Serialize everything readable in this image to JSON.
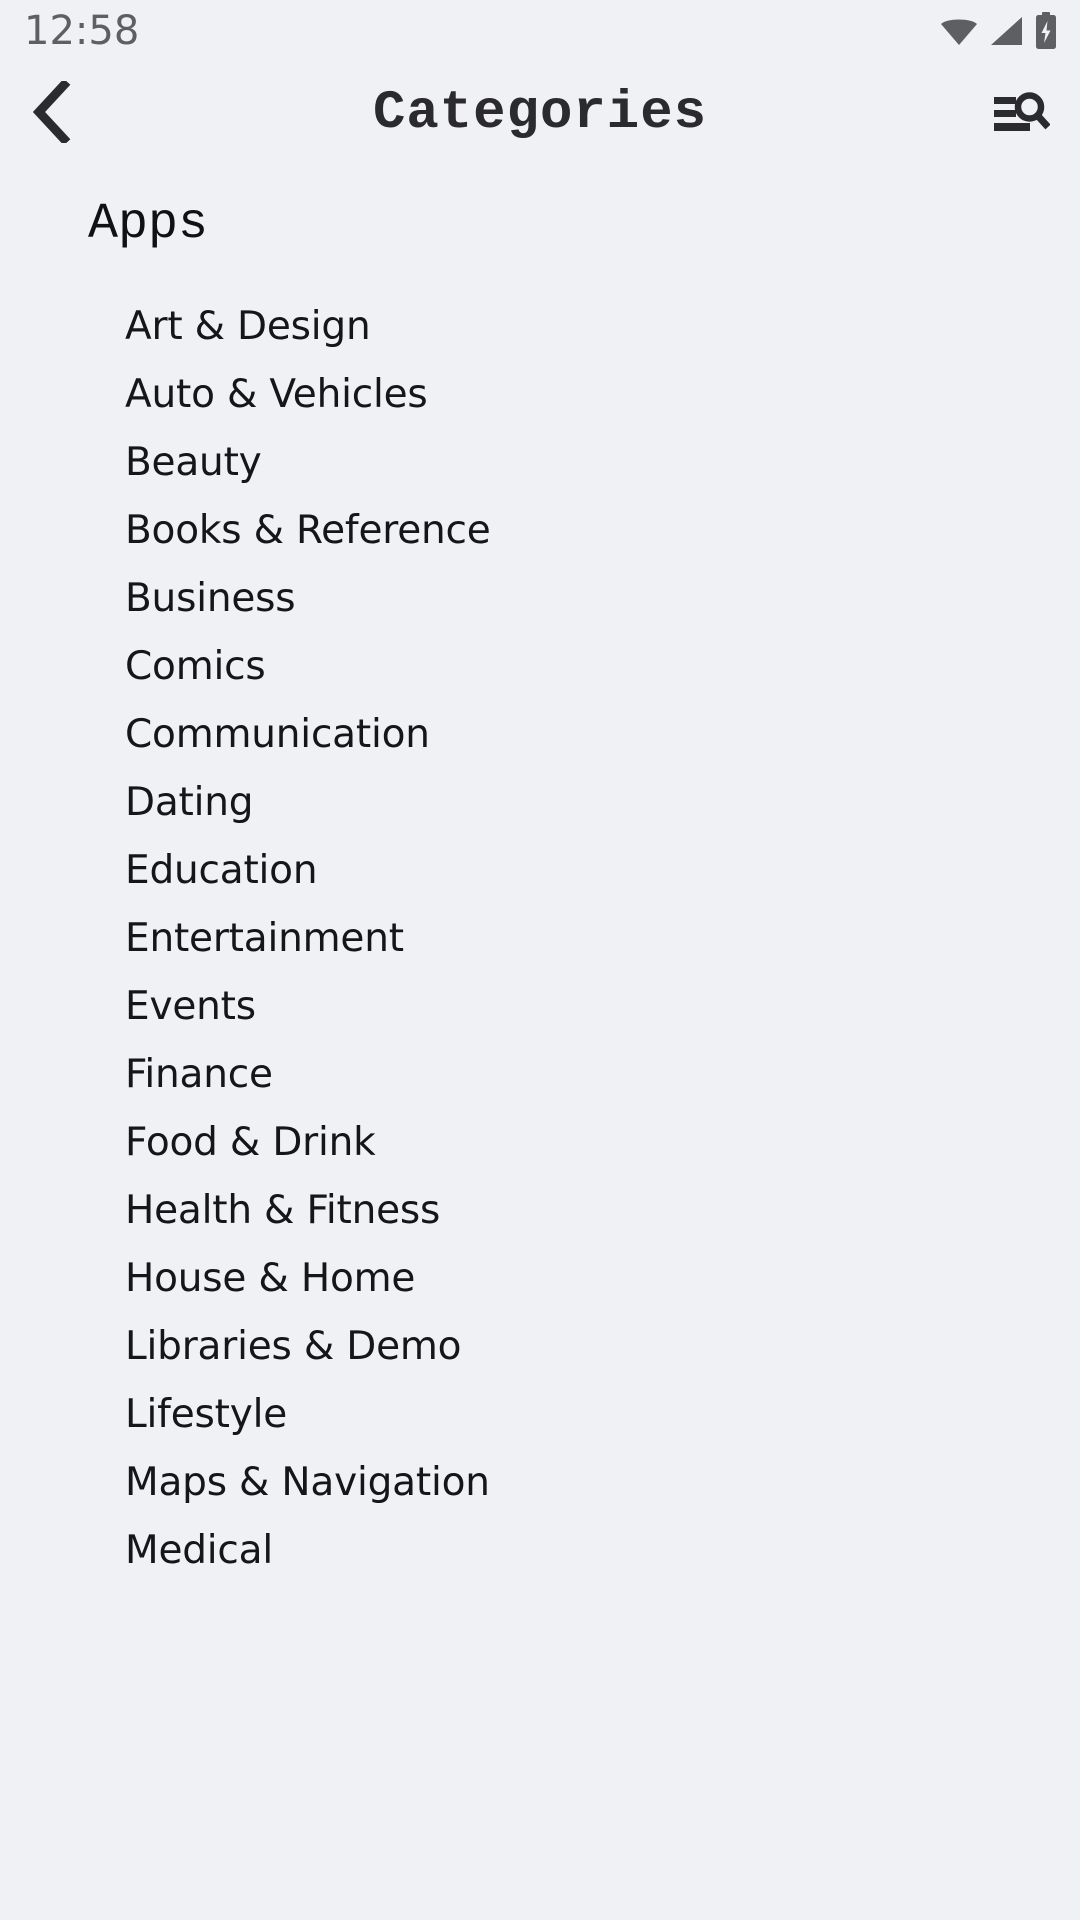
{
  "status_bar": {
    "time": "12:58",
    "icons": [
      {
        "name": "wifi-icon",
        "label": "wifi"
      },
      {
        "name": "cellular-signal-icon",
        "label": "cellular signal"
      },
      {
        "name": "battery-charging-icon",
        "label": "battery charging"
      }
    ],
    "icon_color": "#5d5f63"
  },
  "app_bar": {
    "back_label": "‹",
    "title": "Categories",
    "filter_search_label": "filter and search"
  },
  "content": {
    "section_header": "Apps",
    "categories": [
      {
        "label": "Art & Design"
      },
      {
        "label": "Auto & Vehicles"
      },
      {
        "label": "Beauty"
      },
      {
        "label": "Books & Reference"
      },
      {
        "label": "Business"
      },
      {
        "label": "Comics"
      },
      {
        "label": "Communication"
      },
      {
        "label": "Dating"
      },
      {
        "label": "Education"
      },
      {
        "label": "Entertainment"
      },
      {
        "label": "Events"
      },
      {
        "label": "Finance"
      },
      {
        "label": "Food & Drink"
      },
      {
        "label": "Health & Fitness"
      },
      {
        "label": "House & Home"
      },
      {
        "label": "Libraries & Demo"
      },
      {
        "label": "Lifestyle"
      },
      {
        "label": "Maps & Navigation"
      },
      {
        "label": "Medical"
      }
    ]
  },
  "colors": {
    "background": "#f0f1f5",
    "primary_text": "#15161a",
    "title_text": "#2b2b2d",
    "status_text": "#5d5f63"
  }
}
